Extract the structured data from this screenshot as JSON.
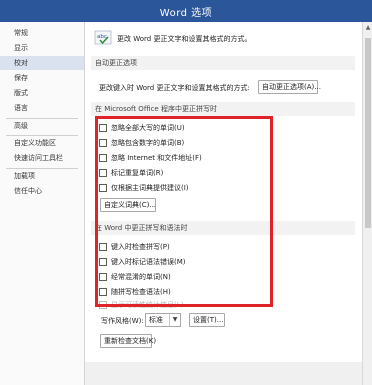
{
  "window": {
    "title": "Word 选项"
  },
  "sidebar": {
    "items": [
      {
        "label": "常规"
      },
      {
        "label": "显示"
      },
      {
        "label": "校对",
        "active": true
      },
      {
        "label": "保存"
      },
      {
        "label": "版式"
      },
      {
        "label": "语言"
      },
      {
        "label": "高级"
      },
      {
        "label": "自定义功能区"
      },
      {
        "label": "快速访问工具栏"
      },
      {
        "label": "加载项"
      },
      {
        "label": "信任中心"
      }
    ]
  },
  "main": {
    "header_icon": "abc-check-icon",
    "header_text": "更改 Word 更正文字和设置其格式的方式。",
    "autocorrect_section": "自动更正选项",
    "autocorrect_desc": "更改键入时 Word 更正文字和设置其格式的方式:",
    "autocorrect_button": "自动更正选项(A)...",
    "office_section": "在 Microsoft Office 程序中更正拼写时",
    "office_options": [
      {
        "label": "忽略全部大写的单词(U)"
      },
      {
        "label": "忽略包含数字的单词(B)"
      },
      {
        "label": "忽略 Internet 和文件地址(F)"
      },
      {
        "label": "标记重复单词(R)"
      },
      {
        "label": "仅根据主词典提供建议(I)"
      }
    ],
    "custom_dict_button": "自定义词典(C)...",
    "word_section": "在 Word 中更正拼写和语法时",
    "word_options": [
      {
        "label": "键入时检查拼写(P)"
      },
      {
        "label": "键入时标记语法错误(M)"
      },
      {
        "label": "经常混淆的单词(N)"
      },
      {
        "label": "随拼写检查语法(H)"
      },
      {
        "label": "显示可读性统计信息(L)",
        "disabled": true
      }
    ],
    "writing_style_label": "写作风格(W):",
    "writing_style_value": "标准",
    "settings_button": "设置(T)...",
    "recheck_button": "重新检查文档(K)"
  },
  "colors": {
    "titlebar": "#2b579a",
    "highlight_box": "#e0232b",
    "active_sidebar": "#d9e2ee"
  }
}
